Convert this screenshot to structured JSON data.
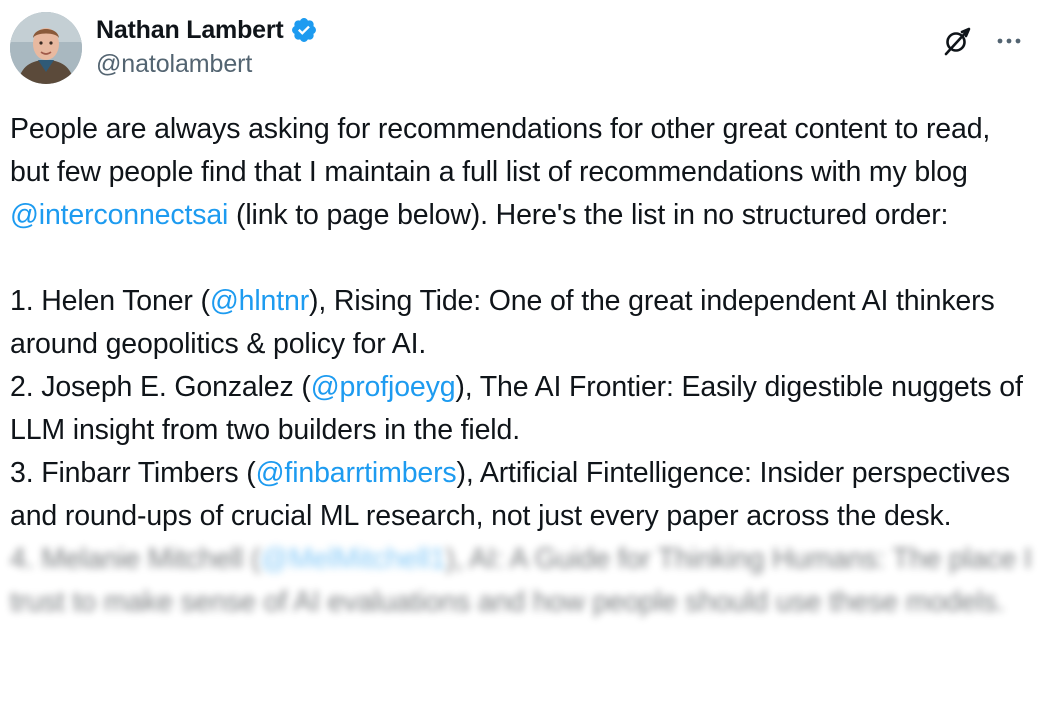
{
  "author": {
    "display_name": "Nathan Lambert",
    "handle": "@natolambert",
    "verified_icon": "verified-badge-icon",
    "avatar": "avatar"
  },
  "header_actions": {
    "grok_icon": "grok-icon",
    "more_icon": "more-icon"
  },
  "colors": {
    "link": "#1d9bf0",
    "text": "#0f1419",
    "muted": "#536471"
  },
  "tweet": {
    "intro_1": "People are always asking for recommendations for other great content to read, but few people find that I maintain a full list of recommendations with my blog ",
    "intro_mention": "@interconnectsai",
    "intro_2": " (link to page below). Here's the list in no structured order:",
    "items": [
      {
        "prefix": "1. Helen Toner (",
        "mention": "@hlntnr",
        "suffix": "), Rising Tide: One of the great independent AI thinkers around geopolitics & policy for AI."
      },
      {
        "prefix": "2. Joseph E. Gonzalez (",
        "mention": "@profjoeyg",
        "suffix": "), The AI Frontier: Easily digestible nuggets of LLM insight from two builders in the field."
      },
      {
        "prefix": "3. Finbarr Timbers (",
        "mention": "@finbarrtimbers",
        "suffix": "), Artificial Fintelligence: Insider perspectives and round-ups of crucial ML research, not just every paper across the desk."
      },
      {
        "prefix": "4. Melanie Mitchell (",
        "mention": "@MelMitchell1",
        "suffix": "), AI: A Guide for Thinking Humans: The place I trust to make sense of AI evaluations and how people should use these models."
      }
    ]
  }
}
